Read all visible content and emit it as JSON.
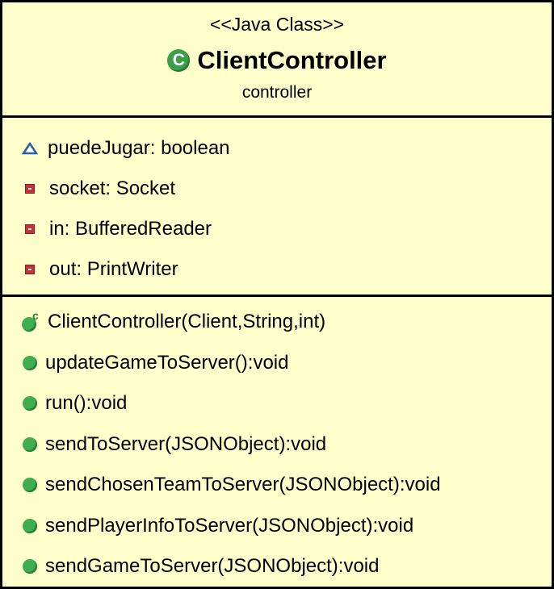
{
  "class_box": {
    "stereotype": "<<Java Class>>",
    "class_icon_letter": "C",
    "class_name": "ClientController",
    "package": "controller"
  },
  "attributes": [
    {
      "visibility": "package-triangle-icon",
      "text": "puedeJugar: boolean"
    },
    {
      "visibility": "private-square-icon",
      "text": "socket: Socket"
    },
    {
      "visibility": "private-square-icon",
      "text": "in: BufferedReader"
    },
    {
      "visibility": "private-square-icon",
      "text": "out: PrintWriter"
    }
  ],
  "operations": [
    {
      "visibility": "constructor-icon",
      "text": "ClientController(Client,String,int)"
    },
    {
      "visibility": "public-circle-icon",
      "text": "updateGameToServer():void"
    },
    {
      "visibility": "public-circle-icon",
      "text": "run():void"
    },
    {
      "visibility": "public-circle-icon",
      "text": "sendToServer(JSONObject):void"
    },
    {
      "visibility": "public-circle-icon",
      "text": "sendChosenTeamToServer(JSONObject):void"
    },
    {
      "visibility": "public-circle-icon",
      "text": "sendPlayerInfoToServer(JSONObject):void"
    },
    {
      "visibility": "public-circle-icon",
      "text": "sendGameToServer(JSONObject):void"
    }
  ],
  "colors": {
    "box_fill": "#ffffcc",
    "border": "#000000",
    "public_green": "#3fae4f",
    "private_red": "#c8303a",
    "package_blue": "#2a5db0"
  }
}
